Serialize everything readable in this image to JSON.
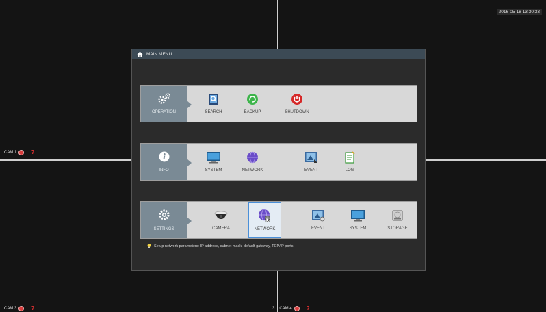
{
  "screen": {
    "timestamp": "2016-05-18 13:30:33",
    "cameras": [
      {
        "label": "CAM 1",
        "q": "?"
      },
      {
        "label": "CAM 3",
        "q": "?"
      },
      {
        "label": "CAM 4",
        "q": "?",
        "prefix": "3"
      }
    ]
  },
  "dialog": {
    "title": "MAIN MENU",
    "rows": [
      {
        "category": {
          "label": "OPERATION",
          "icon": "gears-icon"
        },
        "items": [
          {
            "label": "SEARCH",
            "icon": "search-icon"
          },
          {
            "label": "BACKUP",
            "icon": "backup-icon"
          },
          {
            "label": "SHUTDOWN",
            "icon": "power-icon"
          }
        ]
      },
      {
        "category": {
          "label": "INFO",
          "icon": "info-icon"
        },
        "items": [
          {
            "label": "SYSTEM",
            "icon": "monitor-icon"
          },
          {
            "label": "NETWORK",
            "icon": "globe-icon"
          },
          {
            "label": "EVENT",
            "icon": "event-icon"
          },
          {
            "label": "LOG",
            "icon": "log-icon"
          }
        ]
      },
      {
        "category": {
          "label": "SETTINGS",
          "icon": "settings-icon"
        },
        "items": [
          {
            "label": "CAMERA",
            "icon": "dome-camera-icon"
          },
          {
            "label": "NETWORK",
            "icon": "network-settings-icon",
            "selected": true
          },
          {
            "label": "EVENT",
            "icon": "event-settings-icon"
          },
          {
            "label": "SYSTEM",
            "icon": "monitor-icon"
          },
          {
            "label": "STORAGE",
            "icon": "hdd-icon"
          }
        ]
      }
    ],
    "tip": "Setup network parameters: IP address, subnet mask, default gateway, TCP/IP ports."
  },
  "colors": {
    "background": "#121212",
    "dialog": "#2b2b2b",
    "row": "#d8d8d8",
    "category": "#7a8a95",
    "selection": "#4a8fd8",
    "alert": "#e03030"
  }
}
